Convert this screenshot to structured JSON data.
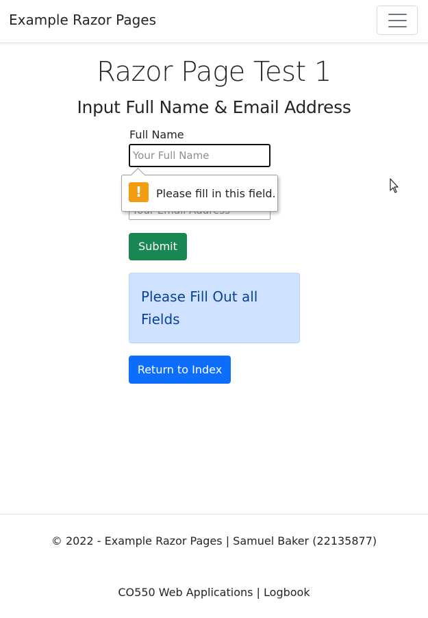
{
  "navbar": {
    "brand": "Example Razor Pages",
    "toggler_icon": "hamburger-menu-icon"
  },
  "header": {
    "title": "Razor Page Test 1",
    "subtitle": "Input Full Name & Email Address"
  },
  "form": {
    "name_label": "Full Name",
    "name_placeholder": "Your Full Name",
    "email_placeholder": "Your Email Address",
    "submit_label": "Submit"
  },
  "validation_tooltip": {
    "icon": "warning-icon",
    "icon_glyph": "!",
    "message": "Please fill in this field."
  },
  "alert": {
    "message": "Please Fill Out all Fields"
  },
  "return_button": {
    "label": "Return to Index"
  },
  "footer": {
    "copyright": "© 2022 - Example Razor Pages | Samuel Baker (22135877)",
    "links": "CO550 Web Applications | Logbook"
  },
  "colors": {
    "submit": "#198754",
    "primary": "#0d6efd",
    "alert_bg": "#cfe2ff",
    "alert_text": "#084298",
    "warning": "#f39c12"
  }
}
